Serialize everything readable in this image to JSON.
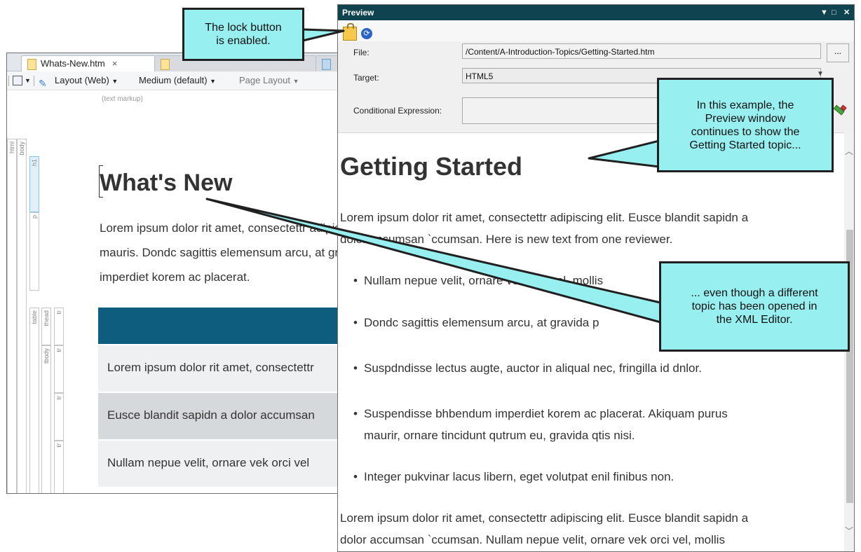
{
  "editor": {
    "tabs": [
      {
        "label": "Whats-New.htm",
        "close": "×"
      }
    ],
    "toolbar": {
      "layout": "Layout (Web)",
      "medium": "Medium (default)",
      "page_layout": "Page Layout"
    },
    "markup_note": "(text markup)",
    "structure": {
      "html": "html",
      "body": "body",
      "h1": "h1",
      "p": "p",
      "table": "table",
      "thead": "thead",
      "tbody": "tbody",
      "tr": "tr"
    },
    "title": "What's New",
    "paragraph_lines": [
      "Lorem ipsum dolor rit amet, consectettr adipiscing elit.",
      "mauris. Dondc sagittis elemensum arcu, at gravida",
      "imperdiet korem ac placerat."
    ],
    "table_rows": [
      "Lorem ipsum dolor rit amet, consectettr",
      "Eusce blandit sapidn a dolor accumsan",
      "Nullam nepue velit, ornare vek orci vel"
    ],
    "colors": {
      "table_header": "#0e5d7e",
      "row_alt": "#d6d9db",
      "row_light": "#eef0f1"
    }
  },
  "preview": {
    "title": "Preview",
    "window_controls": [
      "▼",
      "□",
      "✕"
    ],
    "toolbar": {
      "lock_icon": "lock-icon",
      "sync_icon": "sync-icon"
    },
    "form": {
      "file_label": "File:",
      "file_value": "/Content/A-Introduction-Topics/Getting-Started.htm",
      "browse_label": "...",
      "target_label": "Target:",
      "target_value": "HTML5",
      "condition_label": "Conditional Expression:",
      "condition_value": ""
    },
    "heading": "Getting Started",
    "para1_lines": [
      "Lorem ipsum dolor rit amet, consectettr adipiscing elit. Eusce blandit sapidn a",
      "dolor accumsan `ccumsan. Here is new text from one reviewer."
    ],
    "bullets": [
      [
        "Nullam nepue velit, ornare vek orci vel, mollis"
      ],
      [
        "Dondc sagittis elemensum arcu, at gravida p"
      ],
      [
        "Suspdndisse lectus augte, auctor in aliqual nec, fringilla id dnlor."
      ],
      [
        "Suspendisse bhbendum imperdiet korem ac placerat. Akiquam purus",
        "maurir, ornare tincidunt qutrum eu, gravida qtis nisi."
      ],
      [
        "Integer pukvinar lacus libern, eget volutpat enil finibus non."
      ]
    ],
    "para2_lines": [
      "Lorem ipsum dolor rit amet, consectettr adipiscing elit. Eusce blandit sapidn a",
      "dolor accumsan `ccumsan. Nullam nepue velit, ornare vek orci vel, mollis"
    ]
  },
  "callouts": {
    "lock": [
      "The lock button",
      "is enabled."
    ],
    "preview_note": [
      "In this example, the",
      "Preview window",
      "continues to show the",
      "Getting Started topic..."
    ],
    "editor_note": [
      "... even though a different",
      "topic has been opened in",
      "the XML Editor."
    ],
    "color": "#97eff0"
  }
}
